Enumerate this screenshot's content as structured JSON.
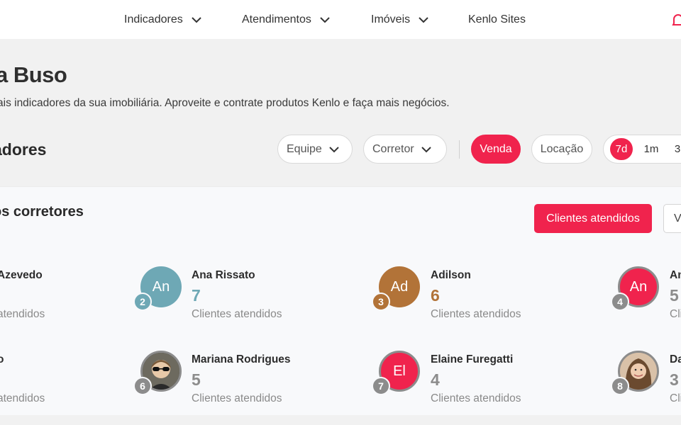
{
  "nav": {
    "items": [
      {
        "label": "Indicadores"
      },
      {
        "label": "Atendimentos"
      },
      {
        "label": "Imóveis"
      },
      {
        "label": "Kenlo Sites"
      }
    ]
  },
  "header": {
    "title": "a Buso",
    "subtitle": "ais indicadores da sua imobiliária. Aproveite e contrate produtos Kenlo e faça mais negócios.",
    "section_title": "adores"
  },
  "filters": {
    "equipe": "Equipe",
    "corretor": "Corretor",
    "venda": "Venda",
    "locacao": "Locação",
    "periods": [
      "7d",
      "1m",
      "3"
    ]
  },
  "panel": {
    "title": "os corretores",
    "primary_button": "Clientes atendidos",
    "secondary_button": "V"
  },
  "brokers": [
    {
      "name": "Azevedo",
      "count": "",
      "label": "atendidos",
      "rank": ""
    },
    {
      "name": "Ana Rissato",
      "initials": "An",
      "count": "7",
      "label": "Clientes atendidos",
      "rank": "2",
      "color": "#6ea8b5",
      "count_color": "#6ea8b5"
    },
    {
      "name": "Adilson",
      "initials": "Ad",
      "count": "6",
      "label": "Clientes atendidos",
      "rank": "3",
      "color": "#b27338",
      "count_color": "#b27338"
    },
    {
      "name": "An",
      "initials": "An",
      "count": "5",
      "label": "Cli",
      "rank": "4",
      "color": "#f0234d",
      "count_color": "#8c8c8c"
    },
    {
      "name": "o",
      "count": "",
      "label": "atendidos",
      "rank": ""
    },
    {
      "name": "Mariana Rodrigues",
      "count": "5",
      "label": "Clientes atendidos",
      "rank": "6",
      "count_color": "#8c8c8c"
    },
    {
      "name": "Elaine Furegatti",
      "initials": "El",
      "count": "4",
      "label": "Clientes atendidos",
      "rank": "7",
      "color": "#f0234d",
      "count_color": "#8c8c8c"
    },
    {
      "name": "Da",
      "count": "3",
      "label": "Cli",
      "rank": "8",
      "count_color": "#8c8c8c"
    }
  ],
  "colors": {
    "accent": "#f0234d",
    "muted": "#8c8c8c"
  }
}
